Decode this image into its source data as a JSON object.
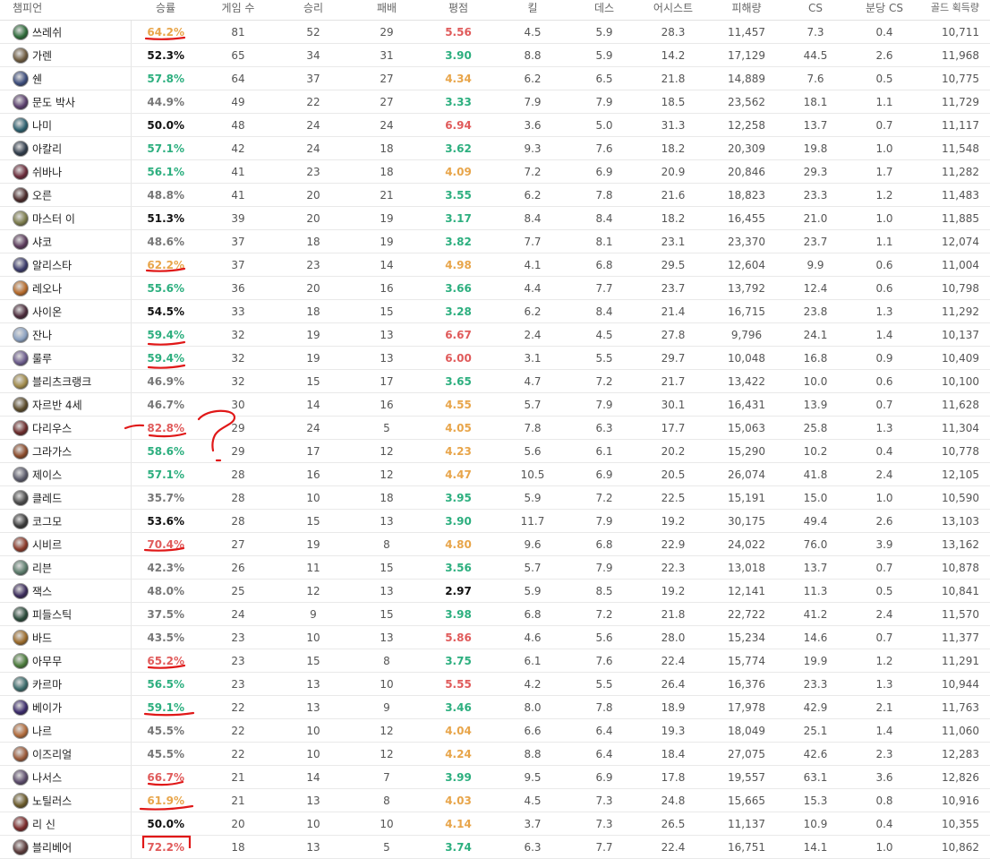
{
  "headers": {
    "champion": "챔피언",
    "winrate": "승률",
    "games": "게임 수",
    "wins": "승리",
    "losses": "패배",
    "kda": "평점",
    "kills": "킬",
    "deaths": "데스",
    "assists": "어시스트",
    "damage": "피해량",
    "cs": "CS",
    "cs_per_min": "분당 CS",
    "gold": "골드 획득량"
  },
  "rows": [
    {
      "name": "쓰레쉬",
      "wr": "64.2%",
      "wr_color": "orange",
      "games": "81",
      "wins": "52",
      "losses": "29",
      "kda": "5.56",
      "kda_color": "red",
      "k": "4.5",
      "d": "5.9",
      "a": "28.3",
      "dmg": "11,457",
      "cs": "7.3",
      "cspm": "0.4",
      "gold": "10,711",
      "avatar": "#2e6b3a"
    },
    {
      "name": "가렌",
      "wr": "52.3%",
      "wr_color": "black",
      "games": "65",
      "wins": "34",
      "losses": "31",
      "kda": "3.90",
      "kda_color": "green",
      "k": "8.8",
      "d": "5.9",
      "a": "14.2",
      "dmg": "17,129",
      "cs": "44.5",
      "cspm": "2.6",
      "gold": "11,968",
      "avatar": "#6d5a3f"
    },
    {
      "name": "쉔",
      "wr": "57.8%",
      "wr_color": "green",
      "games": "64",
      "wins": "37",
      "losses": "27",
      "kda": "4.34",
      "kda_color": "orange",
      "k": "6.2",
      "d": "6.5",
      "a": "21.8",
      "dmg": "14,889",
      "cs": "7.6",
      "cspm": "0.5",
      "gold": "10,775",
      "avatar": "#3b4b7a"
    },
    {
      "name": "문도 박사",
      "wr": "44.9%",
      "wr_color": "gray",
      "games": "49",
      "wins": "22",
      "losses": "27",
      "kda": "3.33",
      "kda_color": "green",
      "k": "7.9",
      "d": "7.9",
      "a": "18.5",
      "dmg": "23,562",
      "cs": "18.1",
      "cspm": "1.1",
      "gold": "11,729",
      "avatar": "#5a3f6d"
    },
    {
      "name": "나미",
      "wr": "50.0%",
      "wr_color": "black",
      "games": "48",
      "wins": "24",
      "losses": "24",
      "kda": "6.94",
      "kda_color": "red",
      "k": "3.6",
      "d": "5.0",
      "a": "31.3",
      "dmg": "12,258",
      "cs": "13.7",
      "cspm": "0.7",
      "gold": "11,117",
      "avatar": "#2c5f6e"
    },
    {
      "name": "아칼리",
      "wr": "57.1%",
      "wr_color": "green",
      "games": "42",
      "wins": "24",
      "losses": "18",
      "kda": "3.62",
      "kda_color": "green",
      "k": "9.3",
      "d": "7.6",
      "a": "18.2",
      "dmg": "20,309",
      "cs": "19.8",
      "cspm": "1.0",
      "gold": "11,548",
      "avatar": "#2f3b4a"
    },
    {
      "name": "쉬바나",
      "wr": "56.1%",
      "wr_color": "green",
      "games": "41",
      "wins": "23",
      "losses": "18",
      "kda": "4.09",
      "kda_color": "orange",
      "k": "7.2",
      "d": "6.9",
      "a": "20.9",
      "dmg": "20,846",
      "cs": "29.3",
      "cspm": "1.7",
      "gold": "11,282",
      "avatar": "#6a2b3a"
    },
    {
      "name": "오른",
      "wr": "48.8%",
      "wr_color": "gray",
      "games": "41",
      "wins": "20",
      "losses": "21",
      "kda": "3.55",
      "kda_color": "green",
      "k": "6.2",
      "d": "7.8",
      "a": "21.6",
      "dmg": "18,823",
      "cs": "23.3",
      "cspm": "1.2",
      "gold": "11,483",
      "avatar": "#4a2a2a"
    },
    {
      "name": "마스터 이",
      "wr": "51.3%",
      "wr_color": "black",
      "games": "39",
      "wins": "20",
      "losses": "19",
      "kda": "3.17",
      "kda_color": "green",
      "k": "8.4",
      "d": "8.4",
      "a": "18.2",
      "dmg": "16,455",
      "cs": "21.0",
      "cspm": "1.0",
      "gold": "11,885",
      "avatar": "#7a7a4a"
    },
    {
      "name": "샤코",
      "wr": "48.6%",
      "wr_color": "gray",
      "games": "37",
      "wins": "18",
      "losses": "19",
      "kda": "3.82",
      "kda_color": "green",
      "k": "7.7",
      "d": "8.1",
      "a": "23.1",
      "dmg": "23,370",
      "cs": "23.7",
      "cspm": "1.1",
      "gold": "12,074",
      "avatar": "#5a3a5a"
    },
    {
      "name": "알리스타",
      "wr": "62.2%",
      "wr_color": "orange",
      "games": "37",
      "wins": "23",
      "losses": "14",
      "kda": "4.98",
      "kda_color": "orange",
      "k": "4.1",
      "d": "6.8",
      "a": "29.5",
      "dmg": "12,604",
      "cs": "9.9",
      "cspm": "0.6",
      "gold": "11,004",
      "avatar": "#3a3a6a"
    },
    {
      "name": "레오나",
      "wr": "55.6%",
      "wr_color": "green",
      "games": "36",
      "wins": "20",
      "losses": "16",
      "kda": "3.66",
      "kda_color": "green",
      "k": "4.4",
      "d": "7.7",
      "a": "23.7",
      "dmg": "13,792",
      "cs": "12.4",
      "cspm": "0.6",
      "gold": "10,798",
      "avatar": "#b56a2a"
    },
    {
      "name": "사이온",
      "wr": "54.5%",
      "wr_color": "black",
      "games": "33",
      "wins": "18",
      "losses": "15",
      "kda": "3.28",
      "kda_color": "green",
      "k": "6.2",
      "d": "8.4",
      "a": "21.4",
      "dmg": "16,715",
      "cs": "23.8",
      "cspm": "1.3",
      "gold": "11,292",
      "avatar": "#4a2a3a"
    },
    {
      "name": "잔나",
      "wr": "59.4%",
      "wr_color": "green",
      "games": "32",
      "wins": "19",
      "losses": "13",
      "kda": "6.67",
      "kda_color": "red",
      "k": "2.4",
      "d": "4.5",
      "a": "27.8",
      "dmg": "9,796",
      "cs": "24.1",
      "cspm": "1.4",
      "gold": "10,137",
      "avatar": "#8aa0c0"
    },
    {
      "name": "룰루",
      "wr": "59.4%",
      "wr_color": "green",
      "games": "32",
      "wins": "19",
      "losses": "13",
      "kda": "6.00",
      "kda_color": "red",
      "k": "3.1",
      "d": "5.5",
      "a": "29.7",
      "dmg": "10,048",
      "cs": "16.8",
      "cspm": "0.9",
      "gold": "10,409",
      "avatar": "#6a5a8a"
    },
    {
      "name": "블리츠크랭크",
      "wr": "46.9%",
      "wr_color": "gray",
      "games": "32",
      "wins": "15",
      "losses": "17",
      "kda": "3.65",
      "kda_color": "green",
      "k": "4.7",
      "d": "7.2",
      "a": "21.7",
      "dmg": "13,422",
      "cs": "10.0",
      "cspm": "0.6",
      "gold": "10,100",
      "avatar": "#a08a4a"
    },
    {
      "name": "자르반 4세",
      "wr": "46.7%",
      "wr_color": "gray",
      "games": "30",
      "wins": "14",
      "losses": "16",
      "kda": "4.55",
      "kda_color": "orange",
      "k": "5.7",
      "d": "7.9",
      "a": "30.1",
      "dmg": "16,431",
      "cs": "13.9",
      "cspm": "0.7",
      "gold": "11,628",
      "avatar": "#5a4a2a"
    },
    {
      "name": "다리우스",
      "wr": "82.8%",
      "wr_color": "red",
      "games": "29",
      "wins": "24",
      "losses": "5",
      "kda": "4.05",
      "kda_color": "orange",
      "k": "7.8",
      "d": "6.3",
      "a": "17.7",
      "dmg": "15,063",
      "cs": "25.8",
      "cspm": "1.3",
      "gold": "11,304",
      "avatar": "#6a2a2a"
    },
    {
      "name": "그라가스",
      "wr": "58.6%",
      "wr_color": "green",
      "games": "29",
      "wins": "17",
      "losses": "12",
      "kda": "4.23",
      "kda_color": "orange",
      "k": "5.6",
      "d": "6.1",
      "a": "20.2",
      "dmg": "15,290",
      "cs": "10.2",
      "cspm": "0.4",
      "gold": "10,778",
      "avatar": "#8a4a2a"
    },
    {
      "name": "제이스",
      "wr": "57.1%",
      "wr_color": "green",
      "games": "28",
      "wins": "16",
      "losses": "12",
      "kda": "4.47",
      "kda_color": "orange",
      "k": "10.5",
      "d": "6.9",
      "a": "20.5",
      "dmg": "26,074",
      "cs": "41.8",
      "cspm": "2.4",
      "gold": "12,105",
      "avatar": "#5a5a6a"
    },
    {
      "name": "클레드",
      "wr": "35.7%",
      "wr_color": "gray",
      "games": "28",
      "wins": "10",
      "losses": "18",
      "kda": "3.95",
      "kda_color": "green",
      "k": "5.9",
      "d": "7.2",
      "a": "22.5",
      "dmg": "15,191",
      "cs": "15.0",
      "cspm": "1.0",
      "gold": "10,590",
      "avatar": "#4a4a4a"
    },
    {
      "name": "코그모",
      "wr": "53.6%",
      "wr_color": "black",
      "games": "28",
      "wins": "15",
      "losses": "13",
      "kda": "3.90",
      "kda_color": "green",
      "k": "11.7",
      "d": "7.9",
      "a": "19.2",
      "dmg": "30,175",
      "cs": "49.4",
      "cspm": "2.6",
      "gold": "13,103",
      "avatar": "#3a3a3a"
    },
    {
      "name": "시비르",
      "wr": "70.4%",
      "wr_color": "red",
      "games": "27",
      "wins": "19",
      "losses": "8",
      "kda": "4.80",
      "kda_color": "orange",
      "k": "9.6",
      "d": "6.8",
      "a": "22.9",
      "dmg": "24,022",
      "cs": "76.0",
      "cspm": "3.9",
      "gold": "13,162",
      "avatar": "#8a3a2a"
    },
    {
      "name": "리븐",
      "wr": "42.3%",
      "wr_color": "gray",
      "games": "26",
      "wins": "11",
      "losses": "15",
      "kda": "3.56",
      "kda_color": "green",
      "k": "5.7",
      "d": "7.9",
      "a": "22.3",
      "dmg": "13,018",
      "cs": "13.7",
      "cspm": "0.7",
      "gold": "10,878",
      "avatar": "#5a7a6a"
    },
    {
      "name": "잭스",
      "wr": "48.0%",
      "wr_color": "gray",
      "games": "25",
      "wins": "12",
      "losses": "13",
      "kda": "2.97",
      "kda_color": "black",
      "k": "5.9",
      "d": "8.5",
      "a": "19.2",
      "dmg": "12,141",
      "cs": "11.3",
      "cspm": "0.5",
      "gold": "10,841",
      "avatar": "#3a2a5a"
    },
    {
      "name": "피들스틱",
      "wr": "37.5%",
      "wr_color": "gray",
      "games": "24",
      "wins": "9",
      "losses": "15",
      "kda": "3.98",
      "kda_color": "green",
      "k": "6.8",
      "d": "7.2",
      "a": "21.8",
      "dmg": "22,722",
      "cs": "41.2",
      "cspm": "2.4",
      "gold": "11,570",
      "avatar": "#2a4a3a"
    },
    {
      "name": "바드",
      "wr": "43.5%",
      "wr_color": "gray",
      "games": "23",
      "wins": "10",
      "losses": "13",
      "kda": "5.86",
      "kda_color": "red",
      "k": "4.6",
      "d": "5.6",
      "a": "28.0",
      "dmg": "15,234",
      "cs": "14.6",
      "cspm": "0.7",
      "gold": "11,377",
      "avatar": "#9a6a2a"
    },
    {
      "name": "아무무",
      "wr": "65.2%",
      "wr_color": "red",
      "games": "23",
      "wins": "15",
      "losses": "8",
      "kda": "3.75",
      "kda_color": "green",
      "k": "6.1",
      "d": "7.6",
      "a": "22.4",
      "dmg": "15,774",
      "cs": "19.9",
      "cspm": "1.2",
      "gold": "11,291",
      "avatar": "#4a7a3a"
    },
    {
      "name": "카르마",
      "wr": "56.5%",
      "wr_color": "green",
      "games": "23",
      "wins": "13",
      "losses": "10",
      "kda": "5.55",
      "kda_color": "red",
      "k": "4.2",
      "d": "5.5",
      "a": "26.4",
      "dmg": "16,376",
      "cs": "23.3",
      "cspm": "1.3",
      "gold": "10,944",
      "avatar": "#3a6a6a"
    },
    {
      "name": "베이가",
      "wr": "59.1%",
      "wr_color": "green",
      "games": "22",
      "wins": "13",
      "losses": "9",
      "kda": "3.46",
      "kda_color": "green",
      "k": "8.0",
      "d": "7.8",
      "a": "18.9",
      "dmg": "17,978",
      "cs": "42.9",
      "cspm": "2.1",
      "gold": "11,763",
      "avatar": "#3a2a6a"
    },
    {
      "name": "나르",
      "wr": "45.5%",
      "wr_color": "gray",
      "games": "22",
      "wins": "10",
      "losses": "12",
      "kda": "4.04",
      "kda_color": "orange",
      "k": "6.6",
      "d": "6.4",
      "a": "19.3",
      "dmg": "18,049",
      "cs": "25.1",
      "cspm": "1.4",
      "gold": "11,060",
      "avatar": "#b06a3a"
    },
    {
      "name": "이즈리얼",
      "wr": "45.5%",
      "wr_color": "gray",
      "games": "22",
      "wins": "10",
      "losses": "12",
      "kda": "4.24",
      "kda_color": "orange",
      "k": "8.8",
      "d": "6.4",
      "a": "18.4",
      "dmg": "27,075",
      "cs": "42.6",
      "cspm": "2.3",
      "gold": "12,283",
      "avatar": "#9a5a3a"
    },
    {
      "name": "나서스",
      "wr": "66.7%",
      "wr_color": "red",
      "games": "21",
      "wins": "14",
      "losses": "7",
      "kda": "3.99",
      "kda_color": "green",
      "k": "9.5",
      "d": "6.9",
      "a": "17.8",
      "dmg": "19,557",
      "cs": "63.1",
      "cspm": "3.6",
      "gold": "12,826",
      "avatar": "#5a4a6a"
    },
    {
      "name": "노틸러스",
      "wr": "61.9%",
      "wr_color": "orange",
      "games": "21",
      "wins": "13",
      "losses": "8",
      "kda": "4.03",
      "kda_color": "orange",
      "k": "4.5",
      "d": "7.3",
      "a": "24.8",
      "dmg": "15,665",
      "cs": "15.3",
      "cspm": "0.8",
      "gold": "10,916",
      "avatar": "#6a5a2a"
    },
    {
      "name": "리 신",
      "wr": "50.0%",
      "wr_color": "black",
      "games": "20",
      "wins": "10",
      "losses": "10",
      "kda": "4.14",
      "kda_color": "orange",
      "k": "3.7",
      "d": "7.3",
      "a": "26.5",
      "dmg": "11,137",
      "cs": "10.9",
      "cspm": "0.4",
      "gold": "10,355",
      "avatar": "#7a2a2a"
    },
    {
      "name": "블리베어",
      "wr": "72.2%",
      "wr_color": "red",
      "games": "18",
      "wins": "13",
      "losses": "5",
      "kda": "3.74",
      "kda_color": "green",
      "k": "6.3",
      "d": "7.7",
      "a": "22.4",
      "dmg": "16,751",
      "cs": "14.1",
      "cspm": "1.0",
      "gold": "10,862",
      "avatar": "#5a3a3a"
    }
  ],
  "annotation": {
    "mark": "?"
  }
}
